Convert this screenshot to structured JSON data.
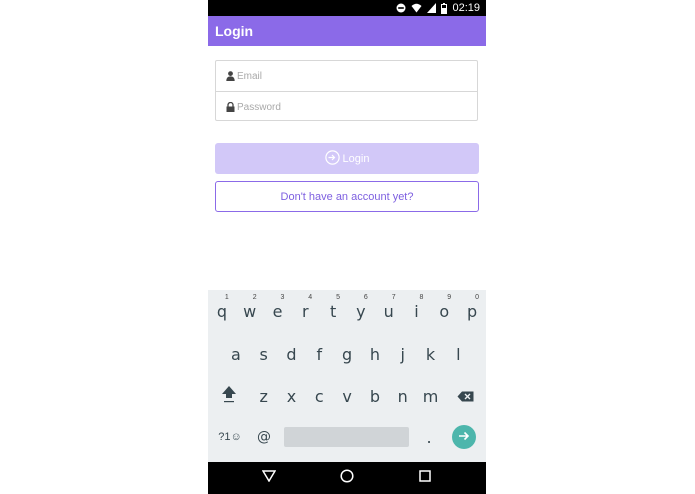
{
  "status_bar": {
    "time": "02:19"
  },
  "app_bar": {
    "title": "Login"
  },
  "form": {
    "email_placeholder": "Email",
    "password_placeholder": "Password"
  },
  "buttons": {
    "login_label": "Login",
    "signup_label": "Don't have an account yet?"
  },
  "keyboard": {
    "row1": [
      {
        "key": "q",
        "hint": "1"
      },
      {
        "key": "w",
        "hint": "2"
      },
      {
        "key": "e",
        "hint": "3"
      },
      {
        "key": "r",
        "hint": "4"
      },
      {
        "key": "t",
        "hint": "5"
      },
      {
        "key": "y",
        "hint": "6"
      },
      {
        "key": "u",
        "hint": "7"
      },
      {
        "key": "i",
        "hint": "8"
      },
      {
        "key": "o",
        "hint": "9"
      },
      {
        "key": "p",
        "hint": "0"
      }
    ],
    "row2": [
      "a",
      "s",
      "d",
      "f",
      "g",
      "h",
      "j",
      "k",
      "l"
    ],
    "row3": [
      "z",
      "x",
      "c",
      "v",
      "b",
      "n",
      "m"
    ],
    "symbols_label": "?1☺",
    "at_label": "@",
    "period_label": "."
  },
  "icons": {
    "status": [
      "do-not-disturb-icon",
      "wifi-icon",
      "cellular-signal-icon",
      "battery-icon"
    ],
    "email_field": "person-icon",
    "password_field": "lock-icon",
    "login_button": "sign-in-icon",
    "keyboard": [
      "shift-icon",
      "backspace-icon",
      "enter-arrow-icon"
    ],
    "nav": [
      "back-icon",
      "home-icon",
      "recents-icon"
    ]
  },
  "colors": {
    "accent": "#8b6ae8",
    "login_button_bg": "#d2c8f8",
    "enter_key": "#4db6ac"
  }
}
